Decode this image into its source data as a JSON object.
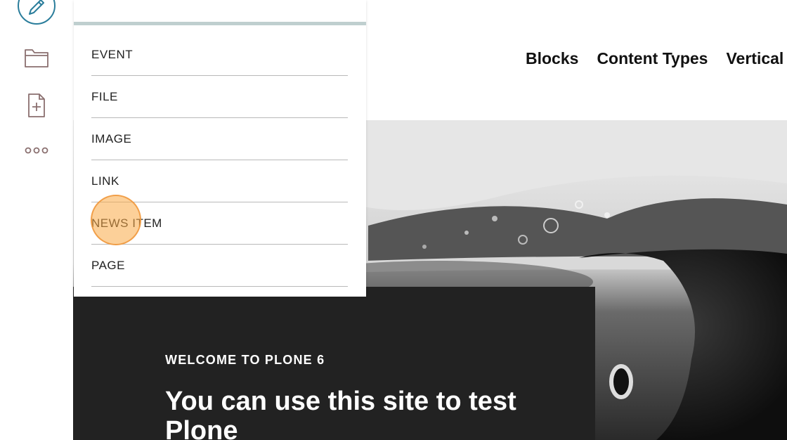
{
  "toolbar": {
    "items": [
      {
        "icon": "pencil-icon"
      },
      {
        "icon": "folder-icon"
      },
      {
        "icon": "add-document-icon"
      },
      {
        "icon": "more-icon"
      }
    ],
    "accent": "#2a7d9b",
    "icon_color": "#8a6f6f"
  },
  "nav": {
    "items": [
      "Blocks",
      "Content Types",
      "Vertical"
    ]
  },
  "add_menu": {
    "search_placeholder": "",
    "items": [
      "EVENT",
      "FILE",
      "IMAGE",
      "LINK",
      "NEWS ITEM",
      "PAGE"
    ],
    "divider_color": "#bfcfcf"
  },
  "hero": {
    "kicker": "WELCOME TO PLONE 6",
    "title": "You can use this site to test Plone"
  },
  "click_marker": {
    "target": "NEWS ITEM",
    "color": "#f7a94a"
  }
}
